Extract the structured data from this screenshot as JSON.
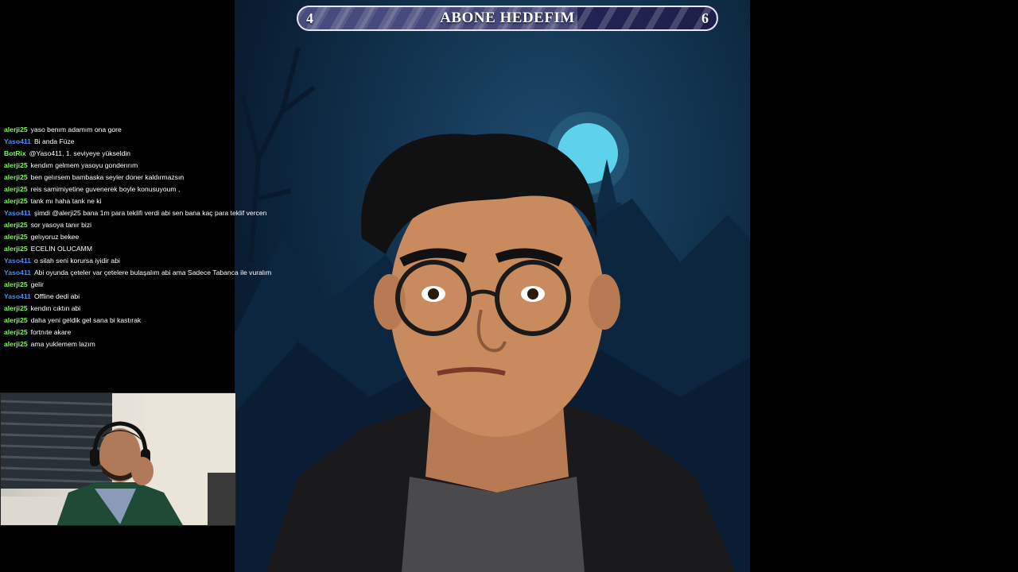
{
  "goal": {
    "title": "ABONE HEDEFIM",
    "current": "4",
    "target": "6",
    "progress_fraction": 0.667
  },
  "chat": {
    "colors": {
      "alerji25": "#7CFC5A",
      "Yaso411": "#4E8FF0",
      "BotRix": "#7CFC5A"
    },
    "messages": [
      {
        "user": "alerji25",
        "text": "yaso benım adamım ona gore"
      },
      {
        "user": "Yaso411",
        "text": "Bi anda Füze"
      },
      {
        "user": "BotRix",
        "text": "@Yaso411, 1. seviyeye yükseldin"
      },
      {
        "user": "alerji25",
        "text": "kendım gelmem yasoyu gonderırım"
      },
      {
        "user": "alerji25",
        "text": "ben gelırsem bambaska seyler doner kaldırmazsın"
      },
      {
        "user": "alerji25",
        "text": "reis samimiyetine guvenerek boyle konusuyoum ,"
      },
      {
        "user": "alerji25",
        "text": "tank mı haha tank ne ki"
      },
      {
        "user": "Yaso411",
        "text": "şimdi @alerji25 bana 1m para teklifi verdi abi sen bana kaç para teklif vercen"
      },
      {
        "user": "alerji25",
        "text": "sor yasoya tanır bizi"
      },
      {
        "user": "alerji25",
        "text": "gelıyoruz bekee"
      },
      {
        "user": "alerji25",
        "text": "ECELİN OLUCAMM"
      },
      {
        "user": "Yaso411",
        "text": "o silah seni korursa iyidir abi"
      },
      {
        "user": "Yaso411",
        "text": "Abi oyunda çeteler var çetelere bulaşalım abi ama Sadece Tabanca ile vuralım"
      },
      {
        "user": "alerji25",
        "text": "gelir"
      },
      {
        "user": "Yaso411",
        "text": "Offline dedi abi"
      },
      {
        "user": "alerji25",
        "text": "kendın cıktın abi"
      },
      {
        "user": "alerji25",
        "text": "daha yeni geldik gel sana bi kastırak"
      },
      {
        "user": "alerji25",
        "text": "fortnıte akare"
      },
      {
        "user": "alerji25",
        "text": "ama yuklemem lazım"
      }
    ]
  },
  "art": {
    "moon_color": "#5fd3ee",
    "sky_color": "#123450"
  }
}
